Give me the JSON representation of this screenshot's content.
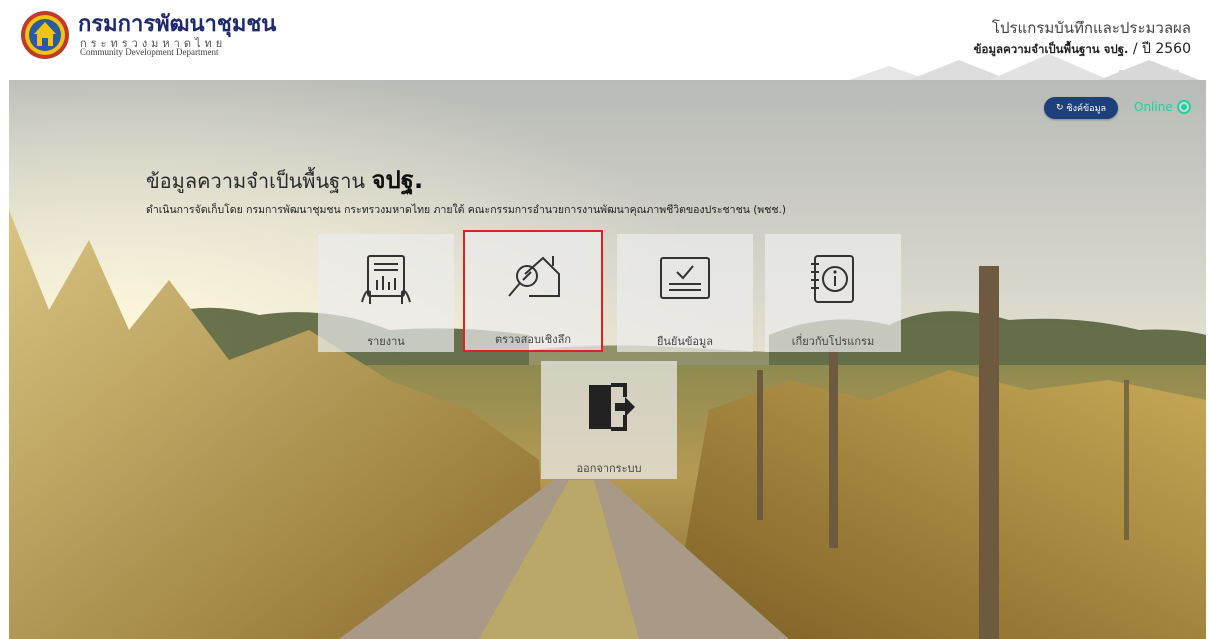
{
  "header": {
    "org_name": "กรมการพัฒนาชุมชน",
    "ministry": "กระทรวงมหาดไทย",
    "org_english": "Community Development Department",
    "program_name": "โปรแกรมบันทึกและประมวลผล",
    "program_subtitle_bold": "ข้อมูลความจำเป็นพื้นฐาน จปฐ.",
    "program_subtitle_year": " / ปี 2560"
  },
  "status": {
    "sync_label": "ซิงค์ข้อมูล",
    "online_label": "Online"
  },
  "main": {
    "headline_prefix": "ข้อมูลความจำเป็นพื้นฐาน ",
    "headline_bold": "จปฐ.",
    "description": "ดำเนินการจัดเก็บโดย กรมการพัฒนาชุมชน กระทรวงมหาดไทย ภายใต้ คณะกรรมการอำนวยการงานพัฒนาคุณภาพชีวิตของประชาชน (พชช.)"
  },
  "menu": {
    "items": [
      {
        "label": "รายงาน",
        "icon": "report-icon"
      },
      {
        "label": "ตรวจสอบเชิงลึก",
        "icon": "inspect-house-icon",
        "selected": true
      },
      {
        "label": "ยืนยันข้อมูล",
        "icon": "confirm-data-icon"
      },
      {
        "label": "เกี่ยวกับโปรแกรม",
        "icon": "about-info-icon"
      },
      {
        "label": "ออกจากระบบ",
        "icon": "logout-icon"
      }
    ]
  },
  "colors": {
    "brand_navy": "#1f2a6e",
    "sync_button": "#1d3f7a",
    "online_green": "#19d3a0",
    "selection_red": "#dd2222"
  }
}
